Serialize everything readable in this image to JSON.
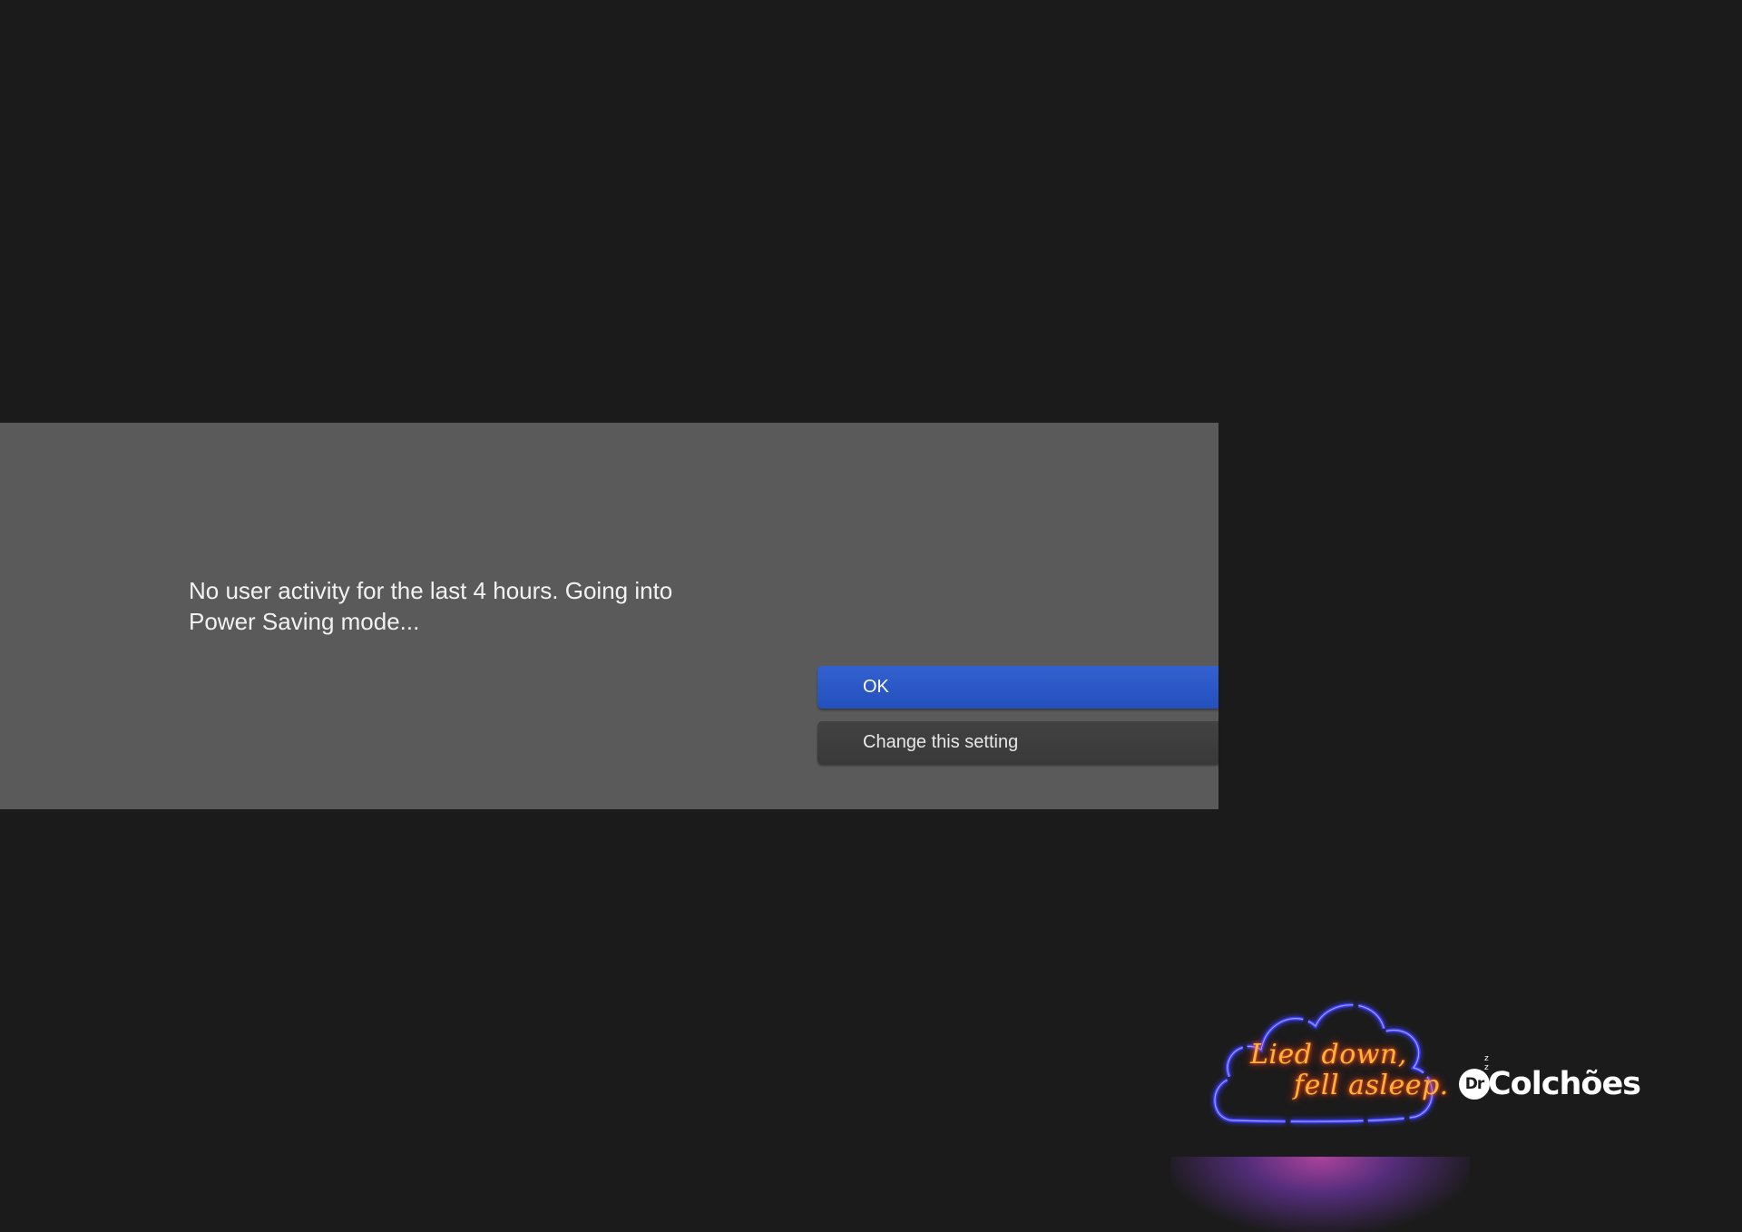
{
  "dialog": {
    "message": "No user activity for the last 4 hours. Going into Power Saving mode...",
    "ok_label": "OK",
    "change_label": "Change this setting",
    "ok_color": "#2d5ac8",
    "change_color": "#404040"
  },
  "ad": {
    "neon_line1": "Lied down,",
    "neon_line2": "fell asleep.",
    "brand_prefix": "Dr",
    "brand_mark": "z z",
    "brand_name": "Colchões",
    "neon_cloud_color": "#3b3cff",
    "neon_text_color": "#ffb23a"
  }
}
